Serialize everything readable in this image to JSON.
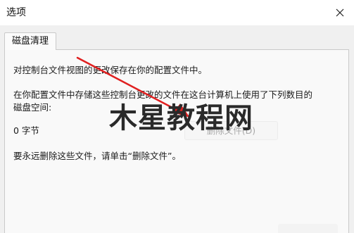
{
  "window": {
    "title": "选项",
    "close_icon": "close-icon"
  },
  "tabs": [
    {
      "label": "磁盘清理",
      "selected": true
    }
  ],
  "panel": {
    "line1": "对控制台文件视图的更改保存在你的配置文件中。",
    "line2": "在你配置文件中存储这些控制台更改的文件在这台计算机上使用了下列数目的",
    "line3": "磁盘空间:",
    "size_value": "0 字节",
    "delete_button_label": "删除文件(D)",
    "delete_button_enabled": false,
    "instruction": "要永远删除这些文件，请单击“删除文件”。"
  },
  "overlay": {
    "watermark_text": "木星教程网",
    "arrow_color": "#e02020"
  }
}
